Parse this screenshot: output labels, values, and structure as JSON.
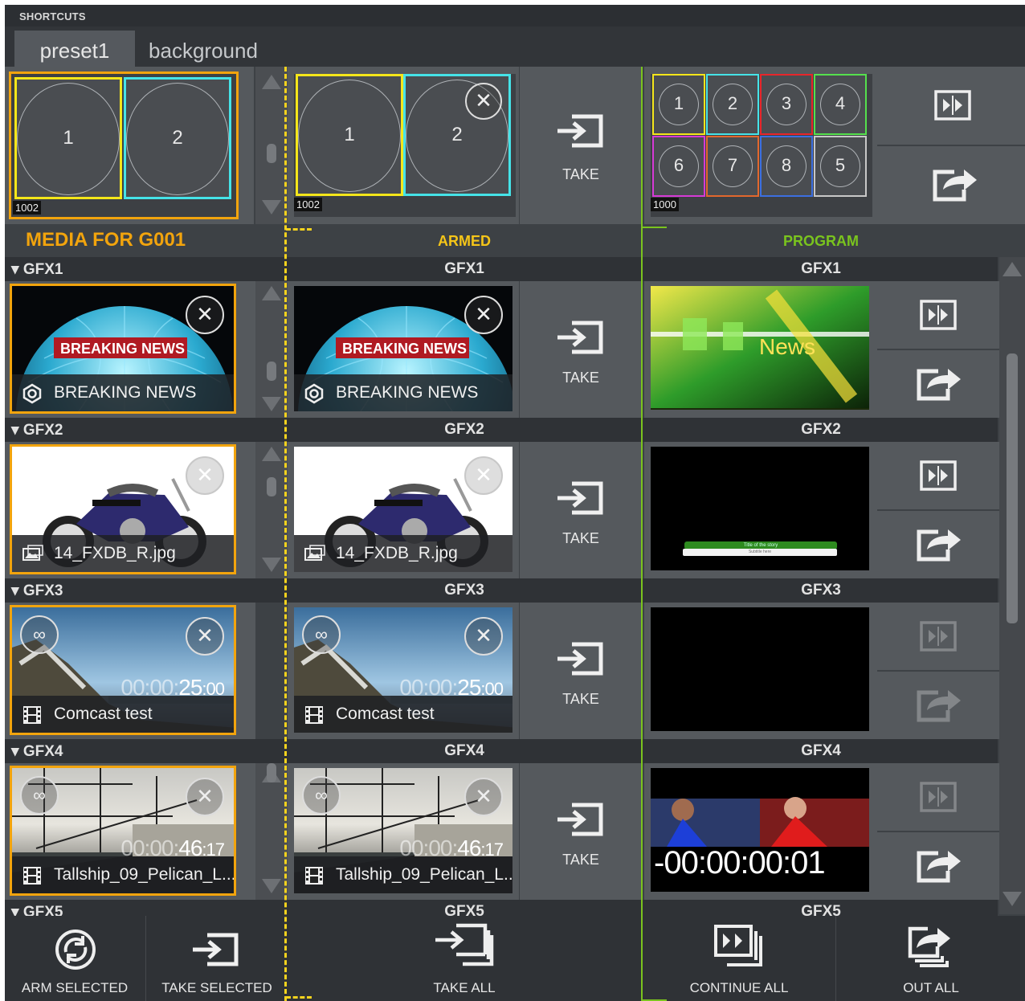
{
  "shortcuts_label": "SHORTCUTS",
  "tabs": [
    {
      "label": "preset1",
      "active": true
    },
    {
      "label": "background",
      "active": false
    }
  ],
  "presets": {
    "media": {
      "cells": [
        "1",
        "2"
      ],
      "id": "1002"
    },
    "armed": {
      "cells": [
        "1",
        "2"
      ],
      "id": "1002"
    },
    "program": {
      "cells": [
        "1",
        "2",
        "3",
        "4",
        "6",
        "7",
        "8",
        "5"
      ],
      "id": "1000"
    }
  },
  "take_label": "TAKE",
  "columns": {
    "media": "MEDIA FOR G001",
    "armed": "ARMED",
    "program": "PROGRAM"
  },
  "gfx": [
    {
      "name": "GFX1",
      "media_caption": "BREAKING NEWS",
      "armed_caption": "BREAKING NEWS",
      "overlay": "BREAKING NEWS"
    },
    {
      "name": "GFX2",
      "media_caption": "14_FXDB_R.jpg",
      "armed_caption": "14_FXDB_R.jpg",
      "program_strap_title": "Title of the story",
      "program_strap_sub": "Subtitle here"
    },
    {
      "name": "GFX3",
      "media_caption": "Comcast test",
      "armed_caption": "Comcast test",
      "time_dim": "00:00:",
      "time_main": "25",
      "time_frac": ":00"
    },
    {
      "name": "GFX4",
      "media_caption": "Tallship_09_Pelican_L...",
      "armed_caption": "Tallship_09_Pelican_L...",
      "time_dim": "00:00:",
      "time_main": "46",
      "time_frac": ":17",
      "program_timer": "-00:00:00:01"
    },
    {
      "name": "GFX5"
    }
  ],
  "program_overlay": "News",
  "bottom": {
    "arm_selected": "ARM SELECTED",
    "take_selected": "TAKE SELECTED",
    "take_all": "TAKE ALL",
    "continue_all": "CONTINUE ALL",
    "out_all": "OUT ALL"
  },
  "colors": {
    "selected": "#f2a40d",
    "armed_line": "#f5d31e",
    "program_line": "#7ac41e",
    "media_title": "#f2a40d",
    "armed_title": "#f5c518",
    "program_title": "#7ac41e"
  }
}
